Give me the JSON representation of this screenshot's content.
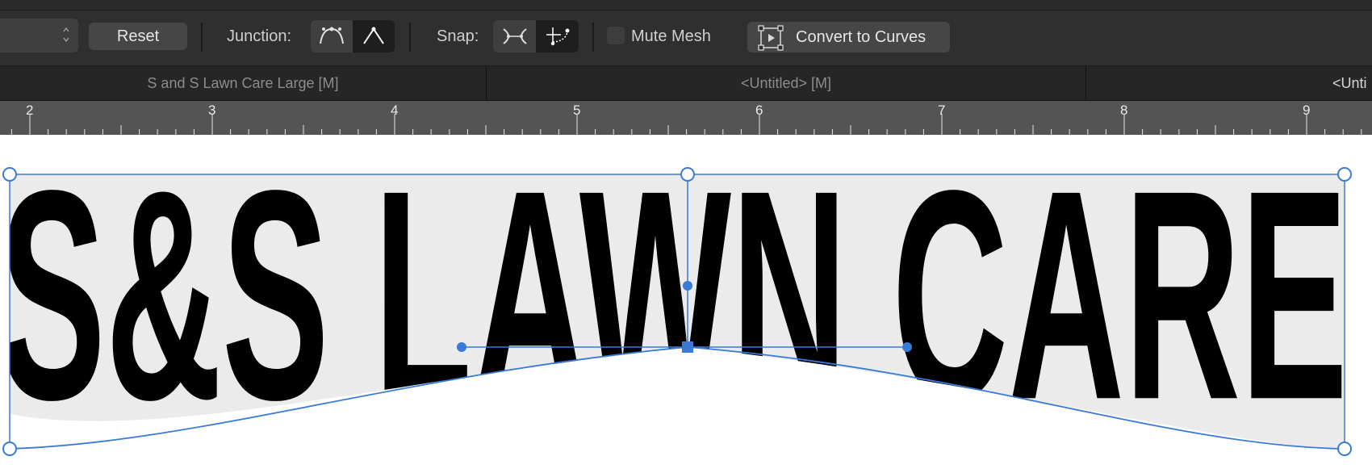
{
  "toolbar": {
    "reset_label": "Reset",
    "junction_label": "Junction:",
    "snap_label": "Snap:",
    "mute_mesh_label": "Mute Mesh",
    "convert_label": "Convert to Curves",
    "stepper_icon": "chevron-up-down-icon",
    "junction_icons": [
      "smooth-junction-icon",
      "sharp-junction-icon"
    ],
    "snap_icons": [
      "snap-to-curve-icon",
      "snap-to-node-icon"
    ]
  },
  "tabs": [
    {
      "label": "S and S Lawn Care Large [M]",
      "active": false
    },
    {
      "label": "<Untitled> [M]",
      "active": false
    },
    {
      "label": "<Unti",
      "active": true
    }
  ],
  "ruler": {
    "numbers": [
      "2",
      "3",
      "4",
      "5",
      "6",
      "7",
      "8",
      "9"
    ]
  },
  "canvas": {
    "artwork_text": "S&S LAWN CARE",
    "colors": {
      "selection": "#3a79d8",
      "text": "#000000",
      "mesh_fill": "#ebebeb"
    }
  }
}
